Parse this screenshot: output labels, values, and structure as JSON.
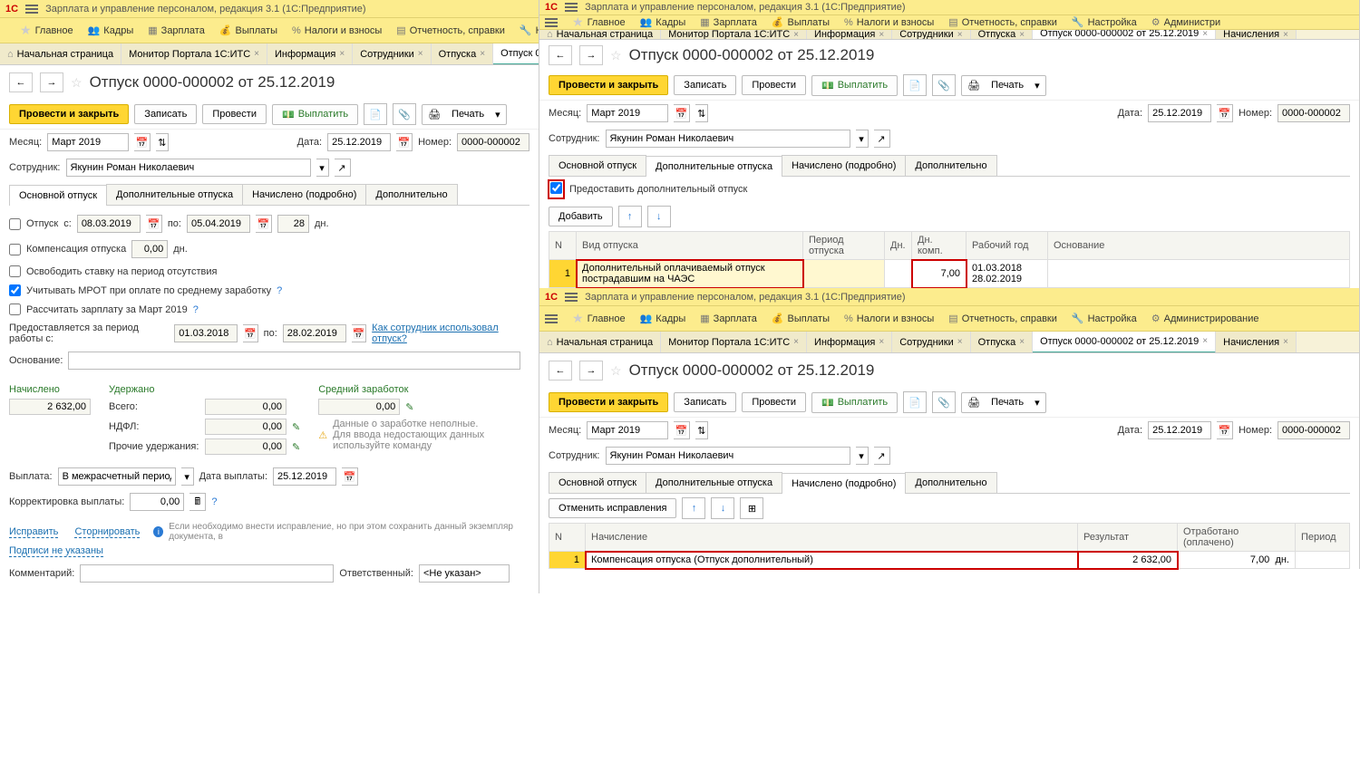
{
  "app_title": "Зарплата и управление персоналом, редакция 3.1  (1С:Предприятие)",
  "menu": {
    "main": "Главное",
    "kadry": "Кадры",
    "zarplata": "Зарплата",
    "vyplaty": "Выплаты",
    "nalogi": "Налоги и взносы",
    "otchetnost": "Отчетность, справки",
    "nastroyka": "Настройка",
    "admin": "Администрирование",
    "admin_short": "Администри"
  },
  "tabs": {
    "home": "Начальная страница",
    "portal": "Монитор Портала 1С:ИТС",
    "info": "Информация",
    "sotr": "Сотрудники",
    "otp": "Отпуска",
    "doc": "Отпуск 0000-000002 от 25.12.2019",
    "nach": "Начисления"
  },
  "doc": {
    "title": "Отпуск 0000-000002 от 25.12.2019",
    "primary": "Провести и закрыть",
    "zapisat": "Записать",
    "provesti": "Провести",
    "vyplatit": "Выплатить",
    "print": "Печать"
  },
  "form": {
    "mesyac_lbl": "Месяц:",
    "mesyac": "Март 2019",
    "data_lbl": "Дата:",
    "data": "25.12.2019",
    "nomer_lbl": "Номер:",
    "nomer": "0000-000002",
    "sotr_lbl": "Сотрудник:",
    "sotr": "Якунин Роман Николаевич"
  },
  "subtabs": {
    "osn": "Основной отпуск",
    "dop": "Дополнительные отпуска",
    "nach": "Начислено (подробно)",
    "dopoln": "Дополнительно"
  },
  "left": {
    "otpusk": "Отпуск",
    "s": "с:",
    "po": "по:",
    "d1": "08.03.2019",
    "d2": "05.04.2019",
    "dn": "28",
    "dn_lbl": "дн.",
    "komp": "Компенсация отпуска",
    "komp_val": "0,00",
    "osvob": "Освободить ставку на период отсутствия",
    "mrot": "Учитывать МРОТ при оплате по среднему заработку",
    "rasch": "Рассчитать зарплату за Март 2019",
    "pred": "Предоставляется за период работы с:",
    "pd1": "01.03.2018",
    "pd2": "28.02.2019",
    "how": "Как сотрудник использовал отпуск?",
    "osnov": "Основание:",
    "nach_h": "Начислено",
    "ud_h": "Удержано",
    "sz_h": "Средний заработок",
    "nach_v": "2 632,00",
    "vsego": "Всего:",
    "zero": "0,00",
    "ndfl": "НДФЛ:",
    "proch": "Прочие удержания:",
    "warn1": "Данные о заработке неполные.",
    "warn2": "Для ввода недостающих данных используйте команду",
    "vypl": "Выплата:",
    "vypl_v": "В межрасчетный период",
    "dvypl": "Дата выплаты:",
    "dvypl_v": "25.12.2019",
    "korr": "Корректировка выплаты:",
    "korr_v": "0,00",
    "ispr": "Исправить",
    "storn": "Сторнировать",
    "ispr_info": "Если необходимо внести исправление, но при этом сохранить данный экземпляр документа, в",
    "podp": "Подписи не указаны",
    "komm": "Комментарий:",
    "otv": "Ответственный:",
    "otv_v": "<Не указан>"
  },
  "tr": {
    "pred_dop": "Предоставить дополнительный отпуск",
    "dobavit": "Добавить",
    "cols": {
      "n": "N",
      "vid": "Вид отпуска",
      "period": "Период отпуска",
      "dn": "Дн.",
      "dnk": "Дн. комп.",
      "god": "Рабочий год",
      "osn": "Основание"
    },
    "row": {
      "n": "1",
      "vid": "Дополнительный оплачиваемый отпуск пострадавшим на ЧАЭС",
      "dnk": "7,00",
      "g1": "01.03.2018",
      "g2": "28.02.2019"
    }
  },
  "br": {
    "otmen": "Отменить исправления",
    "cols": {
      "n": "N",
      "nach": "Начисление",
      "rez": "Результат",
      "otr": "Отработано (оплачено)",
      "per": "Период"
    },
    "row": {
      "n": "1",
      "nach": "Компенсация отпуска (Отпуск дополнительный)",
      "rez": "2 632,00",
      "otr": "7,00",
      "dn": "дн."
    }
  }
}
